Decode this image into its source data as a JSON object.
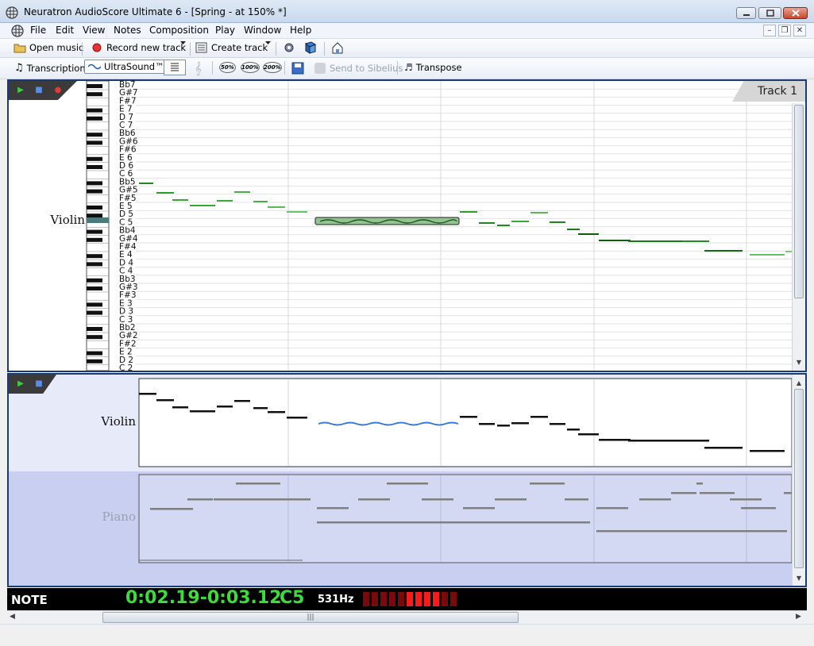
{
  "window": {
    "title": "Neuratron AudioScore Ultimate 6 - [Spring - at 150% *]"
  },
  "menu": {
    "items": [
      "File",
      "Edit",
      "View",
      "Notes",
      "Composition",
      "Play",
      "Window",
      "Help"
    ]
  },
  "toolbar1": {
    "open_music": "Open music",
    "record_new_track": "Record new track",
    "create_track": "Create track"
  },
  "toolbar2": {
    "transcription": "Transcription",
    "ultrasound": "UltraSound™",
    "zoom_50": "50%",
    "zoom_100": "100%",
    "zoom_200": "200%",
    "send_to_sibelius": "Send to Sibelius",
    "transpose": "Transpose"
  },
  "top_panel": {
    "track_tab": "Track 1",
    "instrument": "Violin",
    "note_labels": [
      "Bb7",
      "G#7",
      "F#7",
      "E 7",
      "D 7",
      "C 7",
      "Bb6",
      "G#6",
      "F#6",
      "E 6",
      "D 6",
      "C 6",
      "Bb5",
      "G#5",
      "F#5",
      "E 5",
      "D 5",
      "C 5",
      "Bb4",
      "G#4",
      "F#4",
      "E 4",
      "D 4",
      "C 4",
      "Bb3",
      "G#3",
      "F#3",
      "E 3",
      "D 3",
      "C 3",
      "Bb2",
      "G#2",
      "F#2",
      "E 2",
      "D 2",
      "C 2"
    ]
  },
  "bottom_panel": {
    "instrument_1": "Violin",
    "instrument_2": "Piano"
  },
  "status": {
    "mode": "NOTE",
    "time_range": "0:02.19-0:03.12",
    "note": "C5",
    "frequency": "531Hz",
    "level_meter_lit": 4,
    "level_meter_total": 11,
    "colors": {
      "time": "#3cdc3c",
      "meter_dim": "#7a0a0a",
      "meter_lit": "#ff1a1a"
    }
  }
}
